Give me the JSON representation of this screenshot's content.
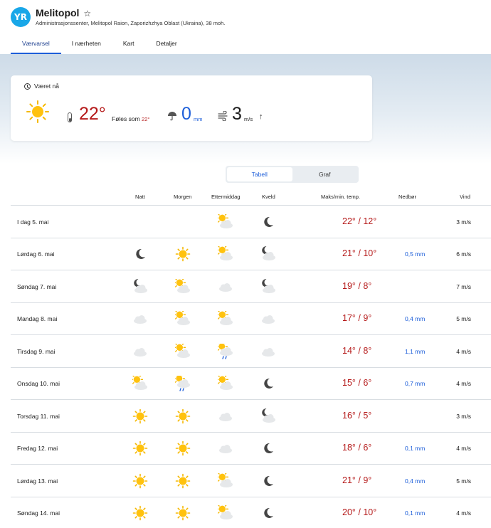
{
  "header": {
    "logo": "YR",
    "title": "Melitopol",
    "star": "☆",
    "subtitle": "Administrasjonssenter, Melitopol Raion, Zaporizhzhya Oblast (Ukraina), 38 moh."
  },
  "tabs": [
    "Værvarsel",
    "I nærheten",
    "Kart",
    "Detaljer"
  ],
  "now": {
    "heading": "Været nå",
    "icon": "sun-icon",
    "temp": "22°",
    "feels_label": "Føles som",
    "feels_value": "22°",
    "precip": "0",
    "precip_unit": "mm",
    "wind": "3",
    "wind_unit": "m/s",
    "wind_arrow": "↑"
  },
  "toggle": {
    "table": "Tabell",
    "graph": "Graf"
  },
  "columns": {
    "night": "Natt",
    "morning": "Morgen",
    "afternoon": "Ettermiddag",
    "evening": "Kveld",
    "temp": "Maks/min. temp.",
    "precip": "Nedbør",
    "wind": "Vind"
  },
  "colors": {
    "temp": "#b51a1a",
    "precip": "#1d5ed9",
    "accent": "#1d5ed9"
  },
  "days": [
    {
      "label": "I dag 5. mai",
      "icons": [
        "",
        "",
        "partly-sunny",
        "moon"
      ],
      "max": "22°",
      "min": "12°",
      "precip": "",
      "wind": "3 m/s"
    },
    {
      "label": "Lørdag 6. mai",
      "icons": [
        "moon",
        "sun",
        "partly-sunny",
        "moon-cloud"
      ],
      "max": "21°",
      "min": "10°",
      "precip": "0,5 mm",
      "wind": "6 m/s"
    },
    {
      "label": "Søndag 7. mai",
      "icons": [
        "moon-cloud",
        "partly-sunny",
        "cloud",
        "moon-cloud"
      ],
      "max": "19°",
      "min": "8°",
      "precip": "",
      "wind": "7 m/s"
    },
    {
      "label": "Mandag 8. mai",
      "icons": [
        "cloud",
        "partly-sunny",
        "partly-sunny",
        "cloud"
      ],
      "max": "17°",
      "min": "9°",
      "precip": "0,4 mm",
      "wind": "5 m/s"
    },
    {
      "label": "Tirsdag 9. mai",
      "icons": [
        "cloud",
        "partly-sunny",
        "sun-rain",
        "cloud"
      ],
      "max": "14°",
      "min": "8°",
      "precip": "1,1 mm",
      "wind": "4 m/s"
    },
    {
      "label": "Onsdag 10. mai",
      "icons": [
        "partly-sunny",
        "sun-rain",
        "partly-sunny",
        "moon"
      ],
      "max": "15°",
      "min": "6°",
      "precip": "0,7 mm",
      "wind": "4 m/s"
    },
    {
      "label": "Torsdag 11. mai",
      "icons": [
        "sun",
        "sun",
        "cloud",
        "moon-cloud"
      ],
      "max": "16°",
      "min": "5°",
      "precip": "",
      "wind": "3 m/s"
    },
    {
      "label": "Fredag 12. mai",
      "icons": [
        "sun",
        "sun",
        "cloud",
        "moon"
      ],
      "max": "18°",
      "min": "6°",
      "precip": "0,1 mm",
      "wind": "4 m/s"
    },
    {
      "label": "Lørdag 13. mai",
      "icons": [
        "sun",
        "sun",
        "partly-sunny",
        "moon"
      ],
      "max": "21°",
      "min": "9°",
      "precip": "0,4 mm",
      "wind": "5 m/s"
    },
    {
      "label": "Søndag 14. mai",
      "icons": [
        "sun",
        "sun",
        "partly-sunny",
        "moon"
      ],
      "max": "20°",
      "min": "10°",
      "precip": "0,1 mm",
      "wind": "4 m/s"
    }
  ]
}
